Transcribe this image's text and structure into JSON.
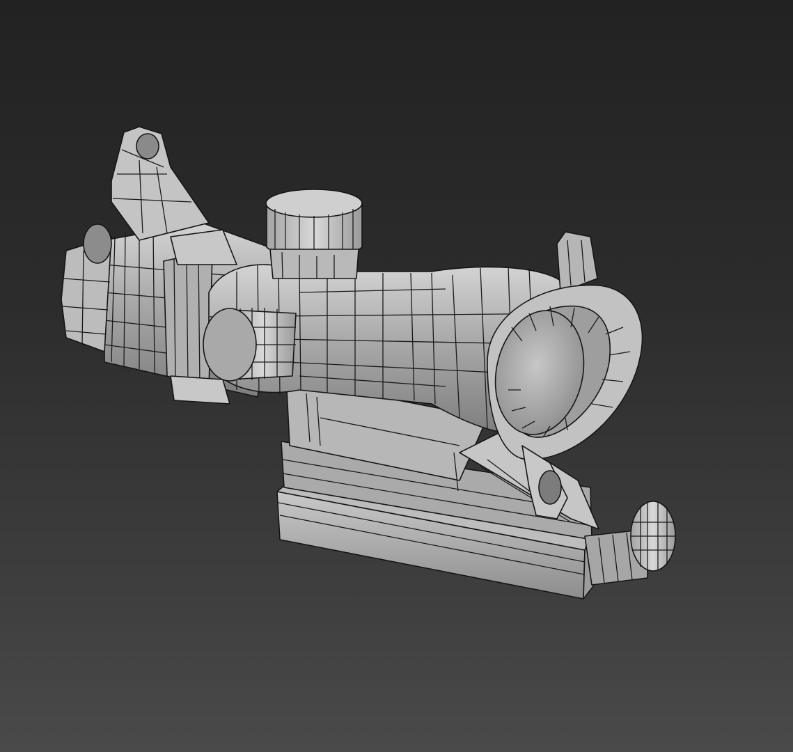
{
  "viewport": {
    "background_top": "#222222",
    "background_bottom": "#4a4a4a",
    "model_color": "#b4b4b4",
    "wire_color": "#1a1a1a"
  },
  "model": {
    "icon": "scope-model-icon"
  }
}
